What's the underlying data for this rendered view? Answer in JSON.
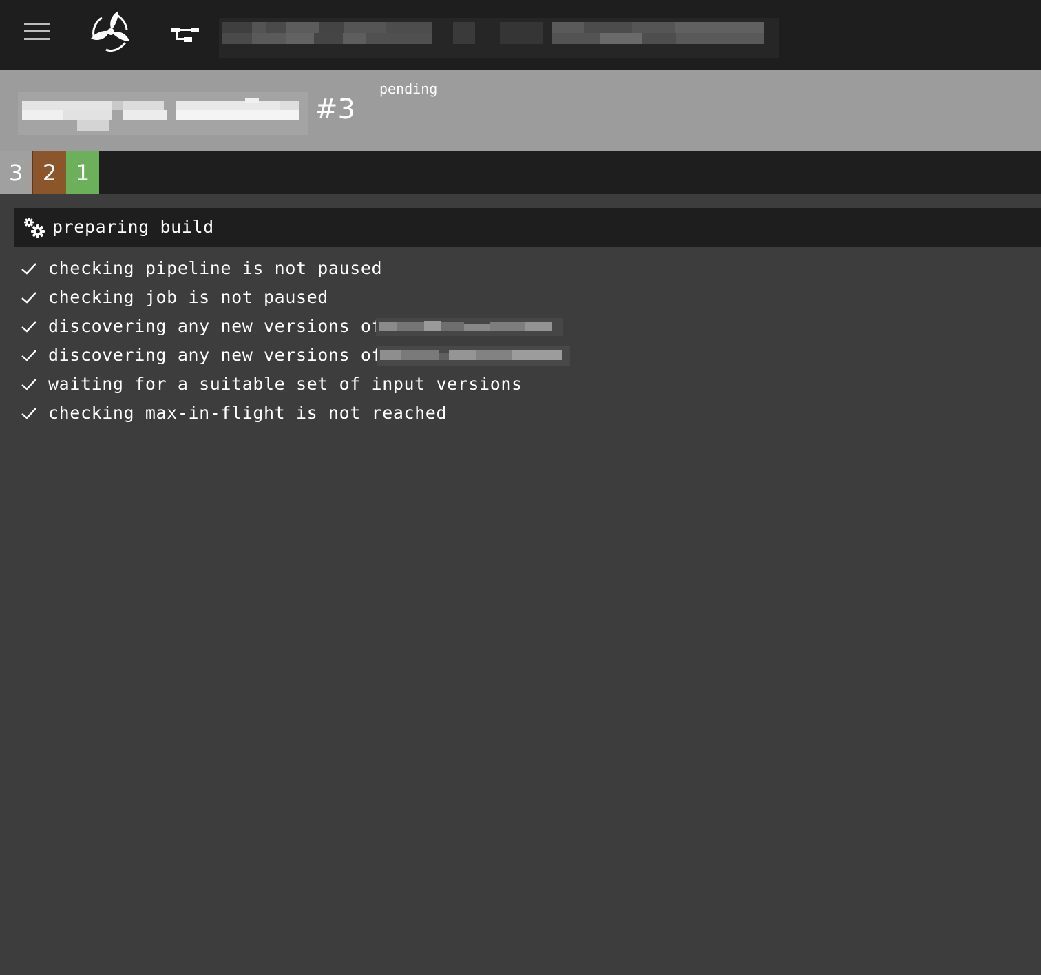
{
  "topbar": {
    "menu_icon": "hamburger-icon",
    "logo_icon": "concourse-logo-icon",
    "pipeline_icon": "pipeline-icon"
  },
  "build": {
    "number": "#3",
    "status": "pending"
  },
  "tabs": [
    {
      "label": "3",
      "color": "#a0a0a0"
    },
    {
      "label": "2",
      "color": "#8b572a"
    },
    {
      "label": "1",
      "color": "#6cb05b"
    }
  ],
  "step": {
    "title": "preparing build",
    "icon": "gears-icon"
  },
  "checks": [
    {
      "text": "checking pipeline is not paused"
    },
    {
      "text": "checking job is not paused"
    },
    {
      "text": "discovering any new versions of"
    },
    {
      "text": "discovering any new versions of"
    },
    {
      "text": "waiting for a suitable set of input versions"
    },
    {
      "text": "checking max-in-flight is not reached"
    }
  ],
  "colors": {
    "topbar_bg": "#1e1e1e",
    "header_band": "#9c9c9c",
    "body_bg": "#3d3d3d",
    "succeeded": "#6cb05b",
    "errored": "#8b572a",
    "pending": "#a0a0a0"
  }
}
